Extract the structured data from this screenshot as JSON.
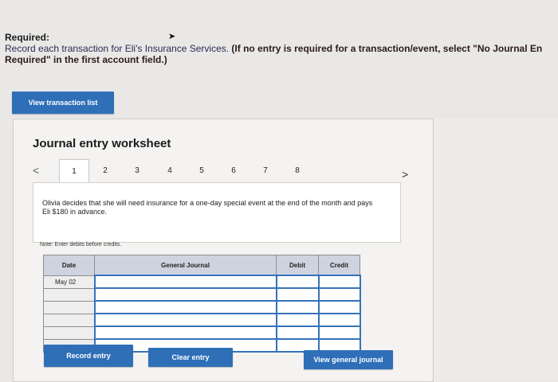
{
  "required": {
    "title": "Required:",
    "line1_plain": "Record each transaction for Eli's Insurance Services. ",
    "line1_bold": "(If no entry is required for a transaction/event, select \"No Journal En",
    "line2": "Required\" in the first account field.)"
  },
  "buttons": {
    "view_transaction_list": "View transaction list",
    "record_entry": "Record entry",
    "clear_entry": "Clear entry",
    "view_general_journal": "View general journal"
  },
  "worksheet": {
    "title": "Journal entry worksheet",
    "nav_prev": "<",
    "nav_next": ">",
    "tabs": [
      "1",
      "2",
      "3",
      "4",
      "5",
      "6",
      "7",
      "8"
    ],
    "active_tab": "1",
    "description": "Olivia decides that she will need insurance for a one-day special event at the end of the month and pays Eli $180 in advance.",
    "note": "Note: Enter debits before credits."
  },
  "journal_table": {
    "headers": {
      "date": "Date",
      "general_journal": "General Journal",
      "debit": "Debit",
      "credit": "Credit"
    },
    "first_date": "May 02"
  }
}
